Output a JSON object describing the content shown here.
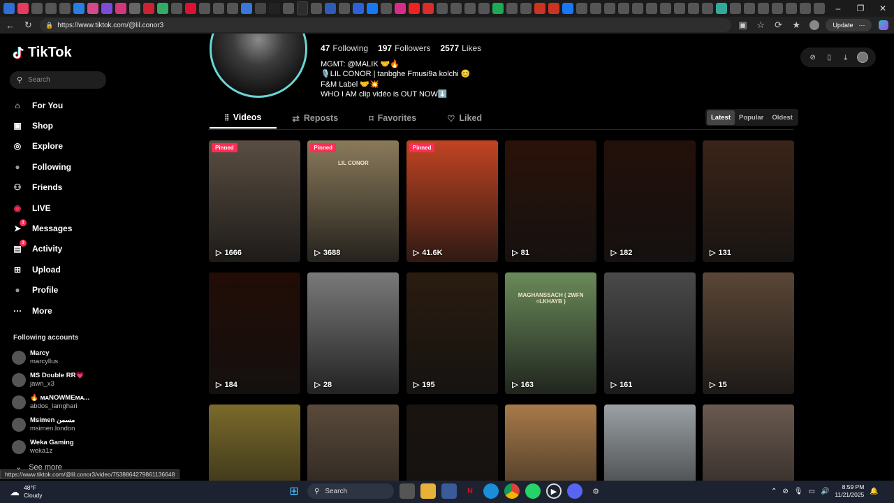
{
  "browser": {
    "url": "https://www.tiktok.com/@lil.conor3",
    "update_label": "Update",
    "tab_colors": [
      "#2f6fd6",
      "#e43c5c",
      "#555",
      "#555",
      "#555",
      "#2a7de1",
      "#d14a8b",
      "#7b4dd6",
      "#d1387a",
      "#666",
      "#c23",
      "#3a6",
      "#555",
      "#d13",
      "#555",
      "#555",
      "#555",
      "#3a77d8",
      "#444",
      "#222",
      "#555",
      "#d33",
      "#555",
      "#2d5db7",
      "#555",
      "#2d62d6",
      "#1877f2",
      "#555",
      "#d62d8a",
      "#e22",
      "#d92d2d",
      "#555",
      "#555",
      "#555",
      "#555",
      "#1fa855",
      "#555",
      "#555",
      "#c32",
      "#c32",
      "#1877f2",
      "#555",
      "#555",
      "#555",
      "#555",
      "#555",
      "#555",
      "#555",
      "#555",
      "#555",
      "#555",
      "#3a9",
      "#555",
      "#555",
      "#555",
      "#555",
      "#555",
      "#555",
      "#555",
      "#555",
      "#555"
    ]
  },
  "sidebar": {
    "logo": "TikTok",
    "search_placeholder": "Search",
    "items": [
      {
        "label": "For You",
        "icon": "home-icon"
      },
      {
        "label": "Shop",
        "icon": "shop-icon"
      },
      {
        "label": "Explore",
        "icon": "compass-icon"
      },
      {
        "label": "Following",
        "icon": "following-avatar-icon"
      },
      {
        "label": "Friends",
        "icon": "friends-icon"
      },
      {
        "label": "LIVE",
        "icon": "live-icon"
      },
      {
        "label": "Messages",
        "icon": "messages-icon",
        "badge": "1"
      },
      {
        "label": "Activity",
        "icon": "activity-icon",
        "badge": "3"
      },
      {
        "label": "Upload",
        "icon": "upload-icon"
      },
      {
        "label": "Profile",
        "icon": "profile-icon"
      },
      {
        "label": "More",
        "icon": "more-icon"
      }
    ],
    "following_header": "Following accounts",
    "accounts": [
      {
        "name": "Marcy",
        "handle": "marcyllus"
      },
      {
        "name": "MS Double RR💗",
        "handle": "jawn_x3"
      },
      {
        "name": "🔥 ᴍᴀNOWMEᴍᴀ...",
        "handle": "abdos_lamghari"
      },
      {
        "name": "Msimen مسمن",
        "handle": "msimen.london"
      },
      {
        "name": "Weka Gaming",
        "handle": "weka1z"
      }
    ],
    "see_more": "See more",
    "status_url": "https://www.tiktok.com/@lil.conor3/video/7538864279861136648"
  },
  "profile": {
    "following_count": "47",
    "following_label": "Following",
    "followers_count": "197",
    "followers_label": "Followers",
    "likes_count": "2577",
    "likes_label": "Likes",
    "bio": [
      "MGMT: @MALIK 🤝🔥",
      "🎙️LIL CONOR | tanbghe Fmusi9a kolchi 😊",
      "F&M Label 🤝💥",
      "WHO I AM clip vidéo is OUT NOW⬇️"
    ]
  },
  "tabs": [
    "Videos",
    "Reposts",
    "Favorites",
    "Liked"
  ],
  "sort": [
    "Latest",
    "Popular",
    "Oldest"
  ],
  "videos": [
    {
      "views": "1666",
      "pinned": "Pinned",
      "bg": "#5a4e42"
    },
    {
      "views": "3688",
      "pinned": "Pinned",
      "bg": "#8a7a5a",
      "overlay": "LIL CONOR"
    },
    {
      "views": "41.6K",
      "pinned": "Pinned",
      "bg": "#c24422"
    },
    {
      "views": "81",
      "bg": "#2a1208"
    },
    {
      "views": "182",
      "bg": "#24100a"
    },
    {
      "views": "131",
      "bg": "#3a2418"
    },
    {
      "views": "184",
      "bg": "#220c06"
    },
    {
      "views": "28",
      "bg": "#7a7a7a"
    },
    {
      "views": "195",
      "bg": "#2a1c10"
    },
    {
      "views": "163",
      "bg": "#6a8a5a",
      "overlay": "MAGHANSSACH ( 2WFN =LKHAYB )"
    },
    {
      "views": "161",
      "bg": "#4a4a4a"
    },
    {
      "views": "15",
      "bg": "#5a4636"
    },
    {
      "views": "",
      "bg": "#7a6a2a"
    },
    {
      "views": "",
      "bg": "#5a4a3a"
    },
    {
      "views": "",
      "bg": "#1a1410"
    },
    {
      "views": "",
      "bg": "#a87a4a"
    },
    {
      "views": "",
      "bg": "#9aa0a4"
    },
    {
      "views": "",
      "bg": "#6a5a50"
    }
  ],
  "taskbar": {
    "temperature": "48°F",
    "weather": "Cloudy",
    "search_label": "Search",
    "time": "8:59 PM",
    "date": "11/21/2025"
  }
}
